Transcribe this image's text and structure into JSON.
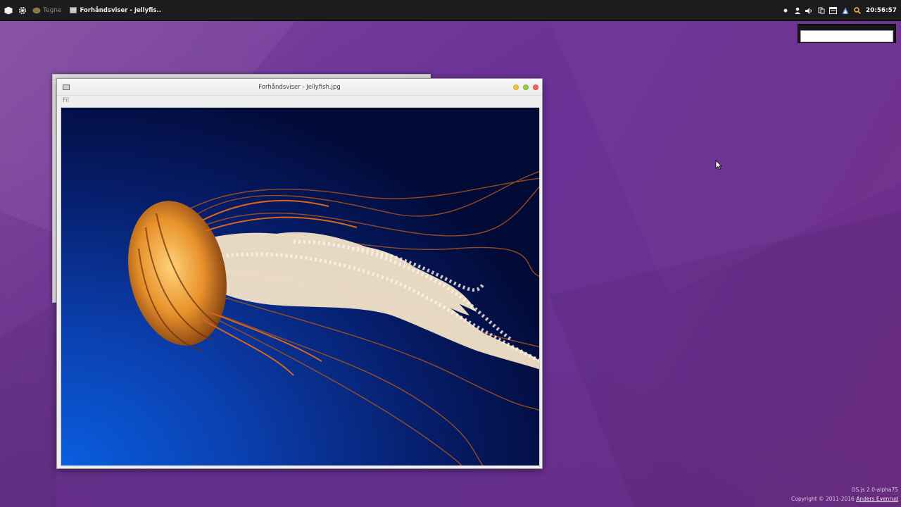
{
  "panel": {
    "launcher_label": "Tegne",
    "task_label": "Forhåndsviser - Jellyfis..",
    "clock": "20:56:57"
  },
  "search": {
    "value": "",
    "placeholder": ""
  },
  "window": {
    "title": "Forhåndsviser - Jellyfish.jpg",
    "menu": [
      "Fil"
    ],
    "image_subject": "jellyfish"
  },
  "footer": {
    "version": "OS.js 2.0-alpha75",
    "copyright": "Copyright © 2011-2016",
    "author": "Anders Evenrud"
  },
  "colors": {
    "desktop": "#6f3497",
    "panel": "#1c1c1f",
    "btn_minimize": "#f2c34a",
    "btn_maximize": "#9ccc4a",
    "btn_close": "#ec6a5e"
  }
}
